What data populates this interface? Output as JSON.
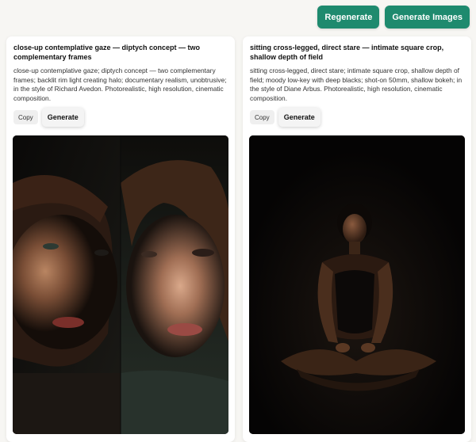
{
  "toolbar": {
    "regenerate_label": "Regenerate",
    "generate_images_label": "Generate Images",
    "accent_color": "#1e8a6e"
  },
  "cards": [
    {
      "title": "close-up contemplative gaze — diptych concept — two complementary frames",
      "description": "close-up contemplative gaze; diptych concept — two complementary frames; backlit rim light creating halo; documentary realism, unobtrusive; in the style of Richard Avedon. Photorealistic, high resolution, cinematic composition.",
      "copy_label": "Copy",
      "generate_label": "Generate",
      "image_subject": "diptych portrait of two women faces in low light"
    },
    {
      "title": "sitting cross-legged, direct stare — intimate square crop, shallow depth of field",
      "description": "sitting cross-legged, direct stare; intimate square crop, shallow depth of field; moody low-key with deep blacks; shot-on 50mm, shallow bokeh; in the style of Diane Arbus. Photorealistic, high resolution, cinematic composition.",
      "copy_label": "Copy",
      "generate_label": "Generate",
      "image_subject": "woman sitting cross-legged in dark low-key lighting"
    }
  ]
}
